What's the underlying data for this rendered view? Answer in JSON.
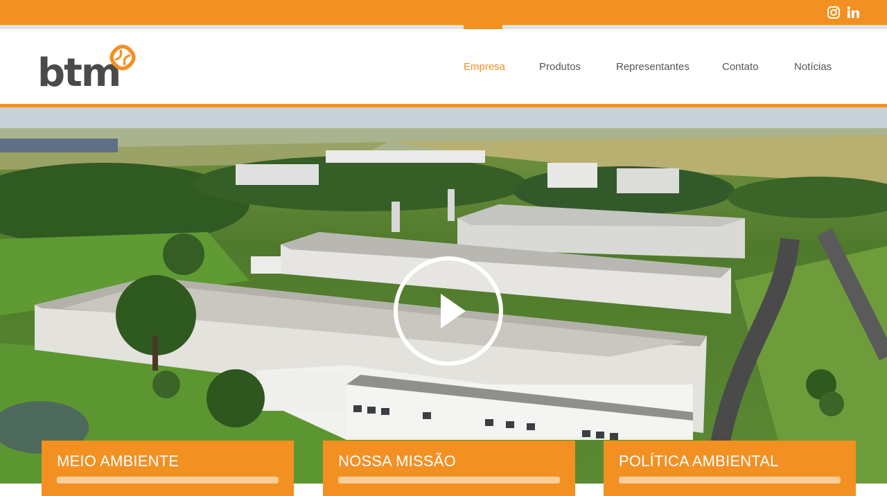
{
  "brand": {
    "logo_text": "btm",
    "accent": "#f39022"
  },
  "social": [
    "instagram-icon",
    "linkedin-icon"
  ],
  "nav": {
    "items": [
      {
        "label": "Empresa",
        "active": true
      },
      {
        "label": "Produtos",
        "active": false
      },
      {
        "label": "Representantes",
        "active": false
      },
      {
        "label": "Contato",
        "active": false
      },
      {
        "label": "Notícias",
        "active": false
      }
    ]
  },
  "hero": {
    "play_icon": "play-icon"
  },
  "cards": [
    {
      "title": "MEIO AMBIENTE"
    },
    {
      "title": "NOSSA MISSÃO"
    },
    {
      "title": "POLÍTICA AMBIENTAL"
    }
  ]
}
